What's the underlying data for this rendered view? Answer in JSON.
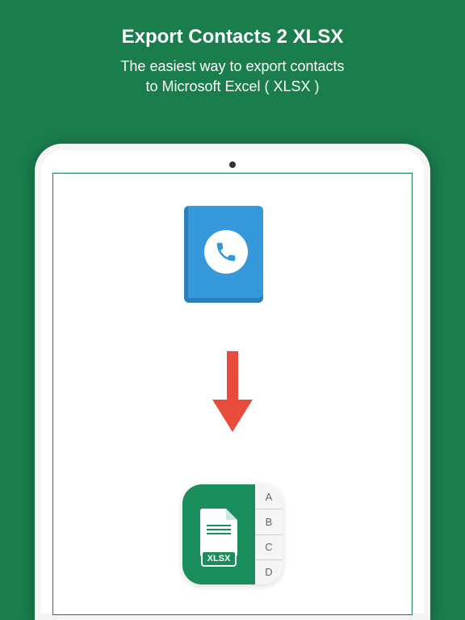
{
  "header": {
    "title": "Export Contacts 2 XLSX",
    "subtitle_line1": "The easiest way to export contacts",
    "subtitle_line2": "to Microsoft Excel ( XLSX )"
  },
  "xlsx": {
    "label": "XLSX",
    "tabs": [
      "A",
      "B",
      "C",
      "D"
    ]
  }
}
